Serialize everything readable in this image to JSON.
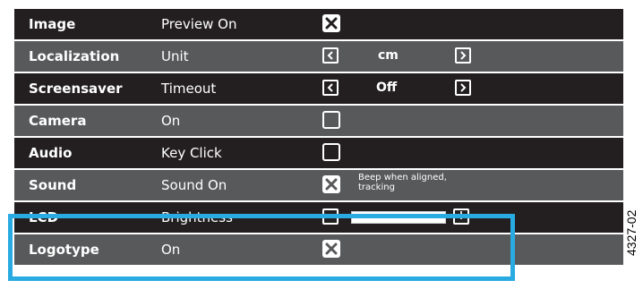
{
  "rows": [
    {
      "name": "Image",
      "setting": "Preview On",
      "control": "checkbox",
      "checked": true,
      "shade": "dark"
    },
    {
      "name": "Localization",
      "setting": "Unit",
      "control": "selector",
      "value": "cm",
      "shade": "light"
    },
    {
      "name": "Screensaver",
      "setting": "Timeout",
      "control": "selector",
      "value": "Off",
      "shade": "dark"
    },
    {
      "name": "Camera",
      "setting": "On",
      "control": "checkbox",
      "checked": false,
      "shade": "light"
    },
    {
      "name": "Audio",
      "setting": "Key Click",
      "control": "checkbox",
      "checked": false,
      "shade": "dark"
    },
    {
      "name": "Sound",
      "setting": "Sound On",
      "control": "checkbox",
      "checked": true,
      "note": "Beep when aligned, tracking",
      "shade": "light"
    },
    {
      "name": "LCD",
      "setting": "Brightness",
      "control": "slider",
      "minus_label": "-",
      "plus_label": "+",
      "level": 1.0,
      "shade": "dark"
    },
    {
      "name": "Logotype",
      "setting": "On",
      "control": "checkbox",
      "checked": true,
      "shade": "light"
    }
  ],
  "figure_id": "4327-02",
  "colors": {
    "dark_row": "#231f20",
    "light_row": "#58595b",
    "highlight": "#29abe2"
  }
}
